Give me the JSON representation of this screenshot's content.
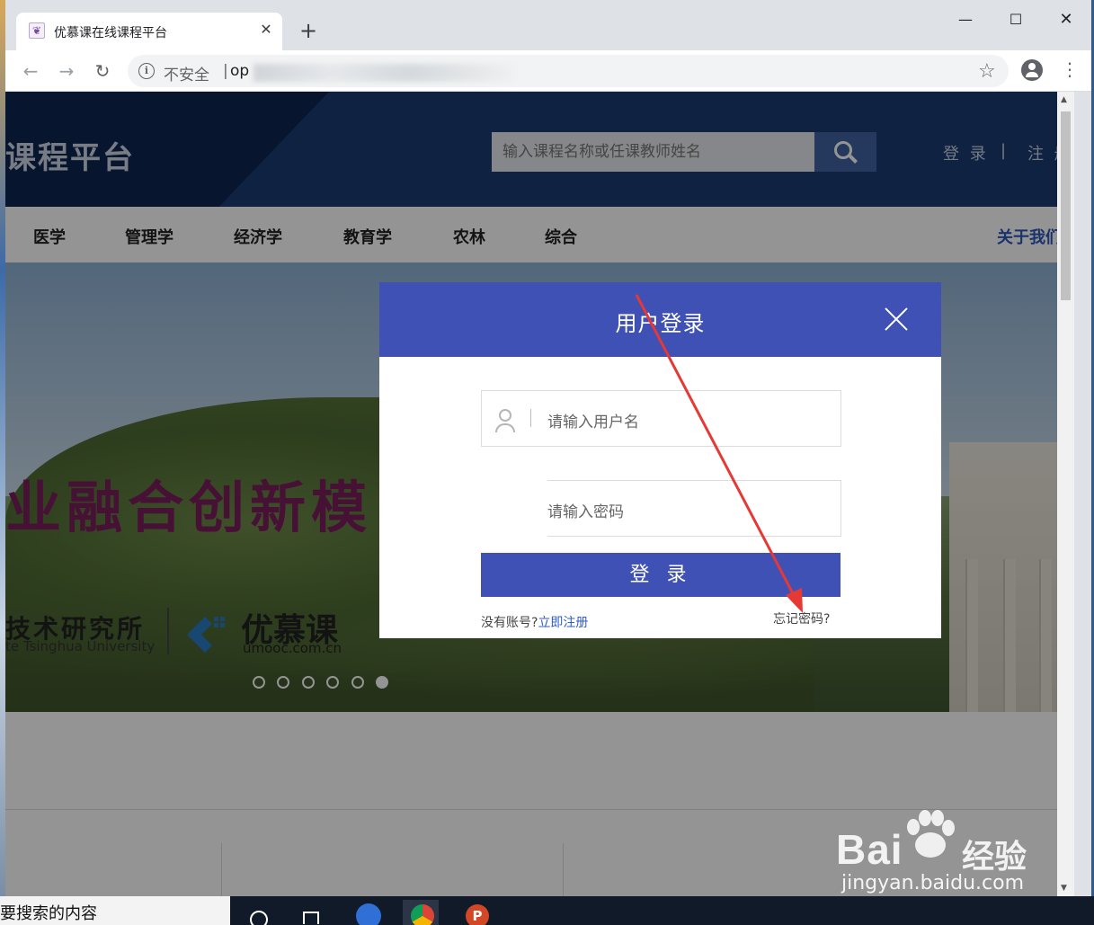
{
  "browser": {
    "tab_title": "优慕课在线课程平台",
    "tab_close": "✕",
    "new_tab": "+",
    "controls": {
      "minimize": "—",
      "maximize": "☐",
      "close": "✕"
    },
    "nav": {
      "back": "←",
      "forward": "→",
      "reload": "↻"
    },
    "security_label": "不安全",
    "separator": "|",
    "url": "op",
    "info_icon": "i",
    "bookmark_star": "☆",
    "menu": "⋮"
  },
  "site": {
    "title": "课程平台",
    "search_placeholder": "输入课程名称或任课教师姓名",
    "login_link": "登 录",
    "link_separator": "|",
    "register_link": "注 册",
    "nav_items": [
      "医学",
      "管理学",
      "经济学",
      "教育学",
      "农林",
      "综合"
    ],
    "about": "关于我们"
  },
  "banner": {
    "slogan": "业融合创新模",
    "institute": "技术研究所",
    "institute_en": "te Tsinghua University",
    "brand": "优慕课",
    "brand_url": "umooc.com.cn",
    "slide_count": 6,
    "active_slide": 6
  },
  "modal": {
    "title": "用户登录",
    "username_placeholder": "请输入用户名",
    "password_placeholder": "请输入密码",
    "login_button": "登 录",
    "no_account": "没有账号?",
    "register_now": "立即注册",
    "forgot_password": "忘记密码?"
  },
  "watermark": {
    "brand": "Bai",
    "brand_cn": "经验",
    "url": "jingyan.baidu.com"
  },
  "taskbar": {
    "search_text": "要搜索的内容"
  },
  "colors": {
    "modal_accent": "#3f51b5",
    "header_bg": "#1c3b72",
    "annotation_arrow": "#e53935"
  },
  "icons": [
    "search-icon",
    "user-icon",
    "close-icon",
    "info-icon",
    "star-icon",
    "account-icon",
    "menu-icon"
  ]
}
